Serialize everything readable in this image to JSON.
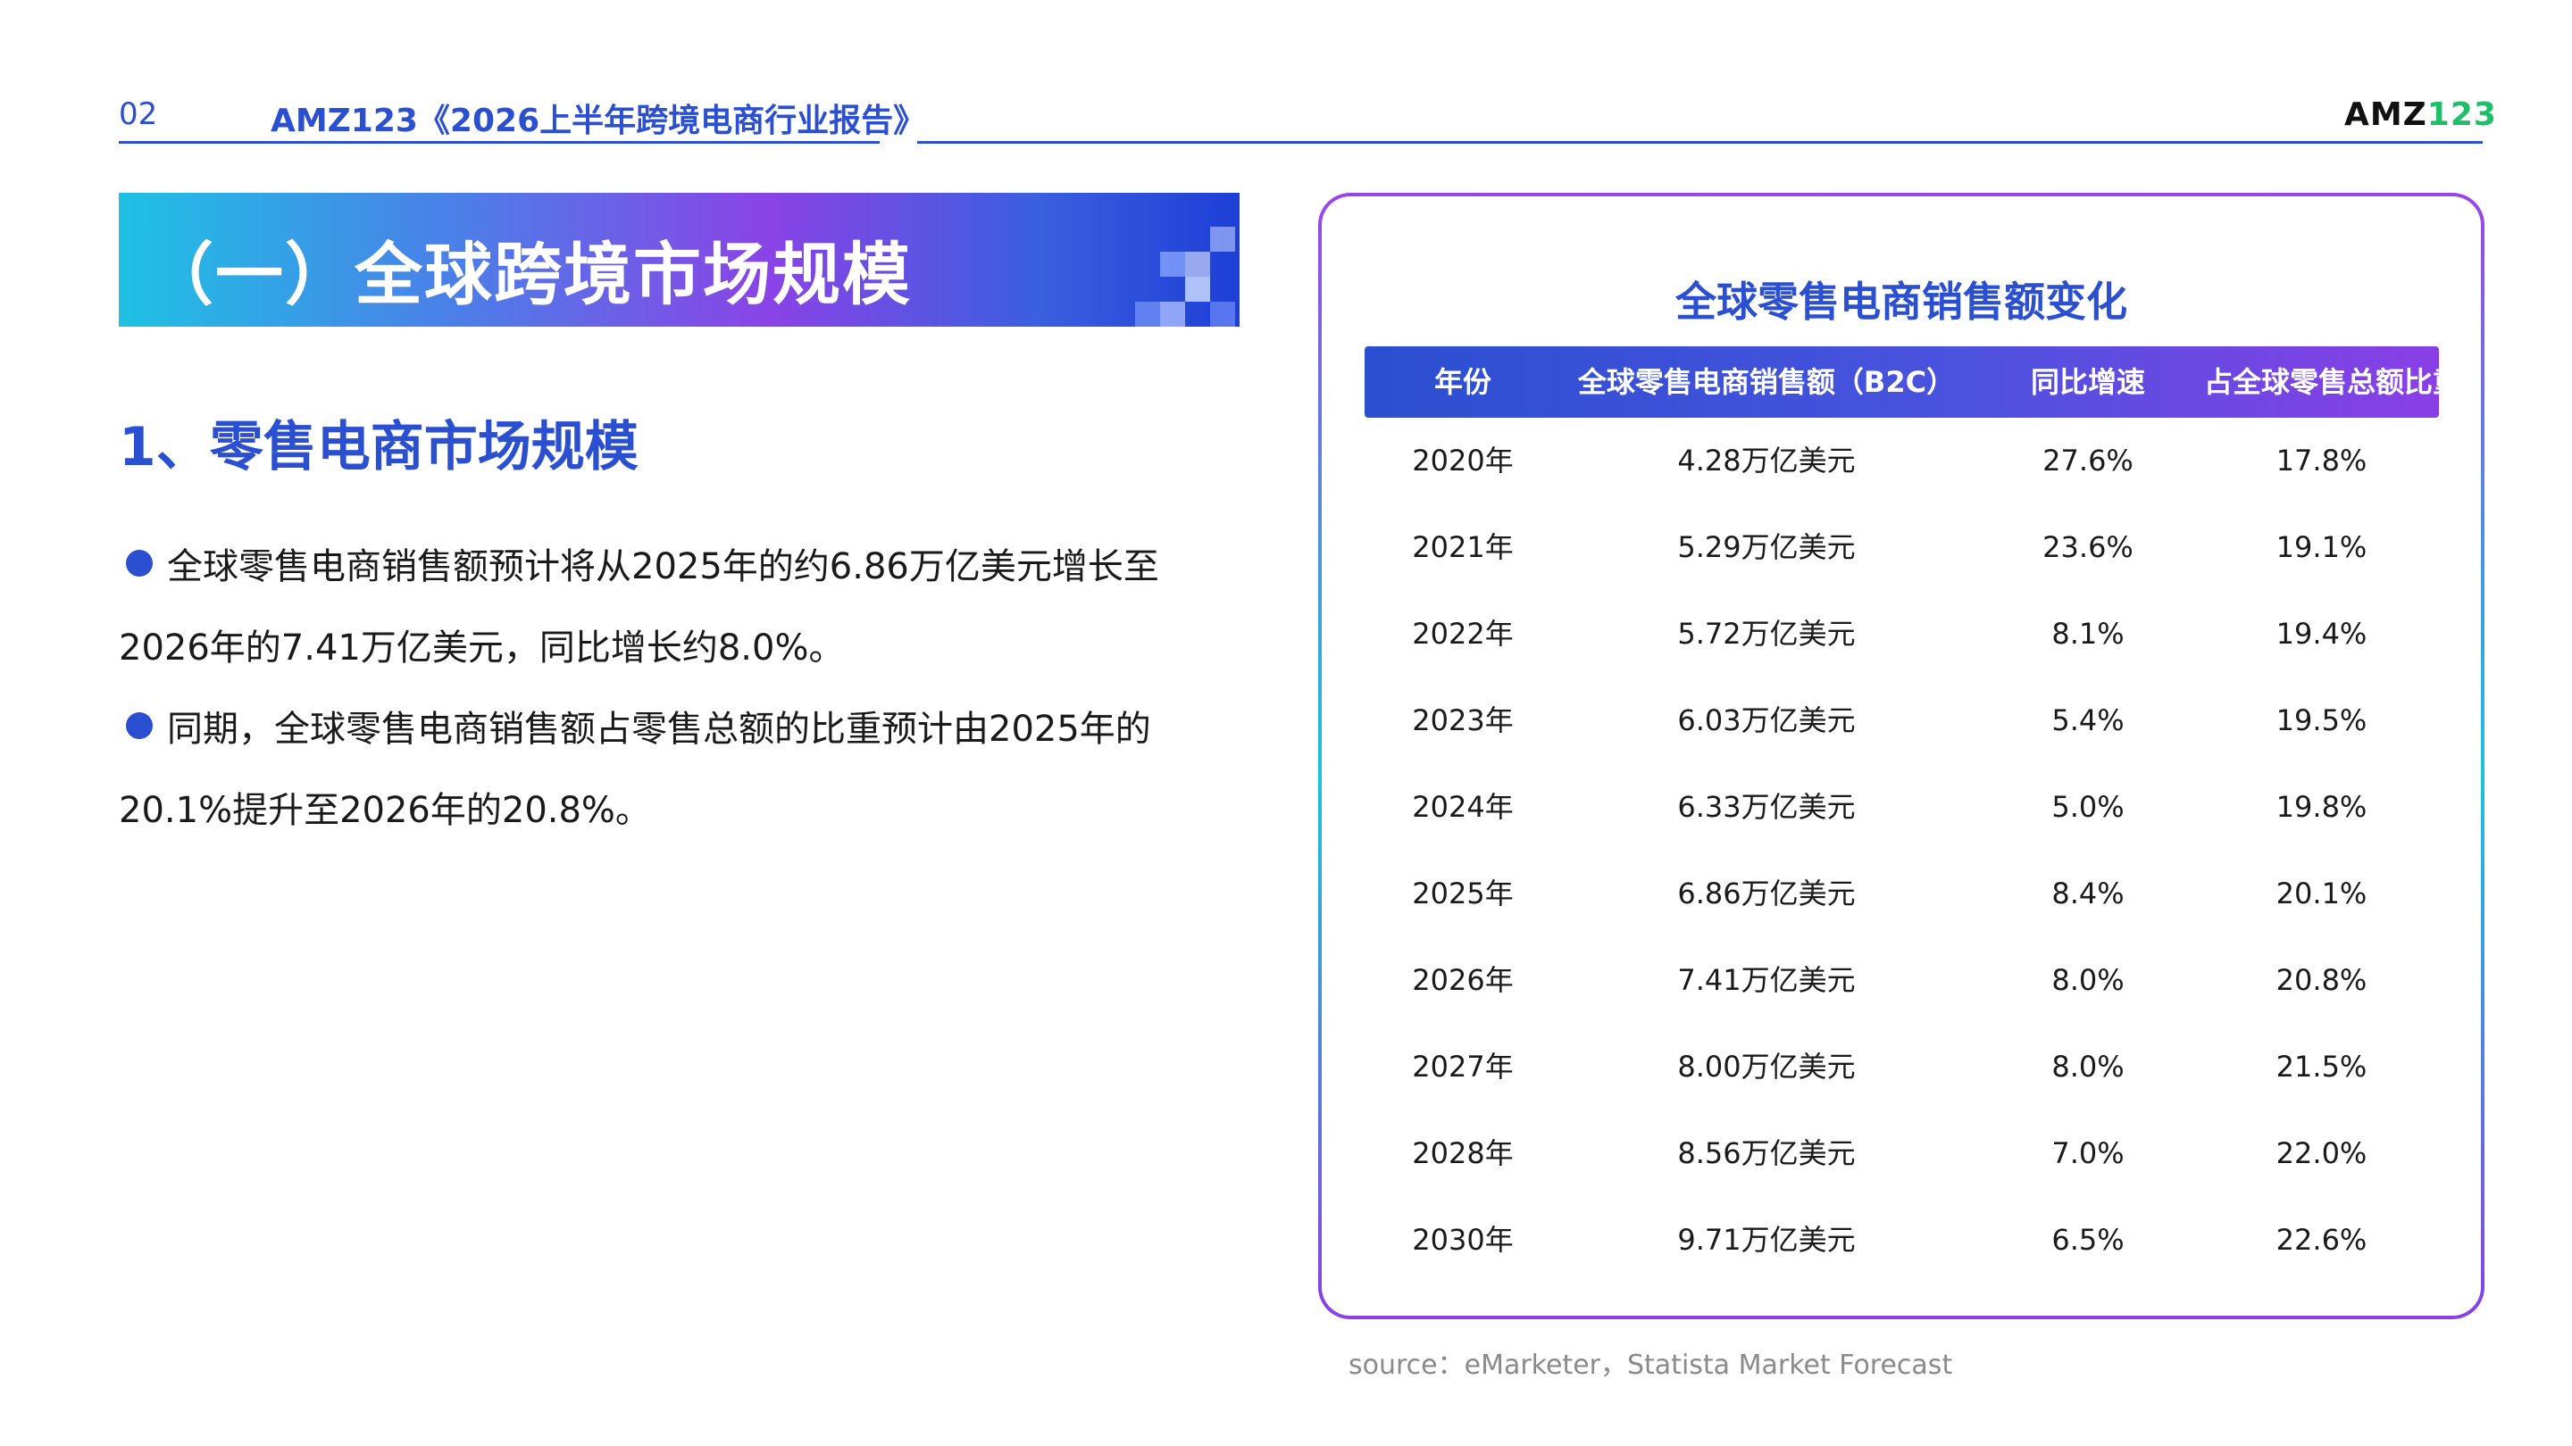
{
  "header": {
    "page_number": "02",
    "report_title": "AMZ123《2026上半年跨境电商行业报告》",
    "logo_part1": "AMZ",
    "logo_part2": "123"
  },
  "section": {
    "title": "（一）全球跨境市场规模",
    "subheading": "1、零售电商市场规模"
  },
  "paragraphs": [
    "全球零售电商销售额预计将从2025年的约6.86万亿美元增长至2026年的7.41万亿美元，同比增长约8.0%。",
    "同期，全球零售电商销售额占零售总额的比重预计由2025年的20.1%提升至2026年的20.8%。"
  ],
  "table_card": {
    "title": "全球零售电商销售额变化",
    "headers": [
      "年份",
      "全球零售电商销售额（B2C）",
      "同比增速",
      "占全球零售总额比重"
    ],
    "rows": [
      [
        "2020年",
        "4.28万亿美元",
        "27.6%",
        "17.8%"
      ],
      [
        "2021年",
        "5.29万亿美元",
        "23.6%",
        "19.1%"
      ],
      [
        "2022年",
        "5.72万亿美元",
        "8.1%",
        "19.4%"
      ],
      [
        "2023年",
        "6.03万亿美元",
        "5.4%",
        "19.5%"
      ],
      [
        "2024年",
        "6.33万亿美元",
        "5.0%",
        "19.8%"
      ],
      [
        "2025年",
        "6.86万亿美元",
        "8.4%",
        "20.1%"
      ],
      [
        "2026年",
        "7.41万亿美元",
        "8.0%",
        "20.8%"
      ],
      [
        "2027年",
        "8.00万亿美元",
        "8.0%",
        "21.5%"
      ],
      [
        "2028年",
        "8.56万亿美元",
        "7.0%",
        "22.0%"
      ],
      [
        "2030年",
        "9.71万亿美元",
        "6.5%",
        "22.6%"
      ]
    ]
  },
  "source": "source：eMarketer，Statista Market Forecast",
  "colors": {
    "accent_blue": "#2b4fd1",
    "accent_purple": "#8a3fe6",
    "accent_cyan": "#19c5d8",
    "logo_green": "#1fbf6a"
  }
}
